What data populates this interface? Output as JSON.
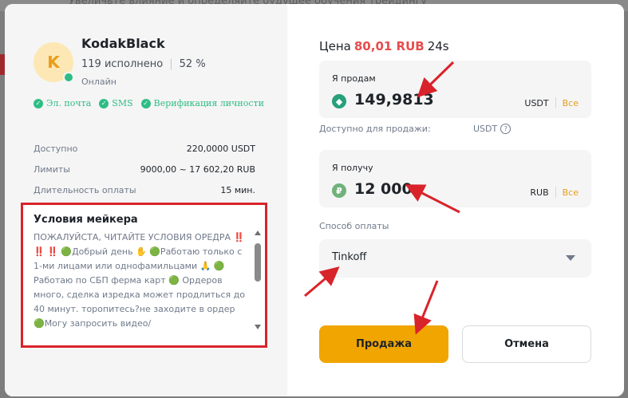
{
  "background": {
    "text": "Увеличьте влияние и определяйте будущее обучения трейдингу",
    "accent_color": "#a0282c"
  },
  "maker": {
    "avatar_letter": "K",
    "name": "KodakBlack",
    "completed": "119 исполнено",
    "rate": "52 %",
    "status": "Онлайн",
    "verifications": [
      "Эл. почта",
      "SMS",
      "Верификация личности"
    ]
  },
  "info": [
    {
      "label": "Доступно",
      "value": "220,0000 USDT"
    },
    {
      "label": "Лимиты",
      "value": "9000,00 ~ 17 602,20 RUB"
    },
    {
      "label": "Длительность оплаты",
      "value": "15 мин."
    }
  ],
  "terms": {
    "title": "Условия мейкера",
    "text": "ПОЖАЛУЙСТА, ЧИТАЙТЕ УСЛОВИЯ ОРЕДРА ‼️ ‼️ ‼️ 🟢Добрый день ✋ 🟢Работаю только с 1-ми лицами или однофамильцами 🙏 🟢Работаю по СБП ферма карт 🟢 Ордеров много, сделка изредка может продлиться до 40 минут. торопитесь?не заходите в ордер 🟢Могу запросить видео/"
  },
  "order": {
    "price_label": "Цена",
    "price_value": "80,01 RUB",
    "time_left": "24s",
    "sell_label": "Я продам",
    "sell_amount": "149,9813",
    "sell_currency": "USDT",
    "all_label": "Все",
    "available_label": "Доступно для продажи:",
    "available_currency": "USDT",
    "receive_label": "Я получу",
    "receive_amount": "12 000",
    "receive_currency": "RUB",
    "payment_label": "Способ оплаты",
    "payment_method": "Tinkoff",
    "sell_button": "Продажа",
    "cancel_button": "Отмена"
  },
  "colors": {
    "accent": "#f0a500",
    "price": "#e74c4c",
    "success": "#2ebd85",
    "annotation": "#d9232a"
  }
}
